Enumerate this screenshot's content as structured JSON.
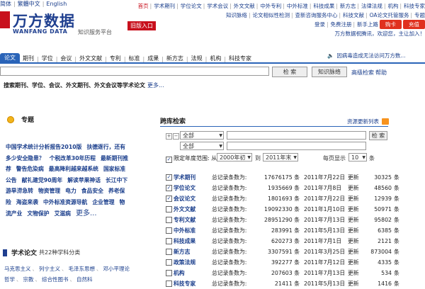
{
  "lang": [
    "简体",
    "繁體中文",
    "English"
  ],
  "logo": {
    "main": "万方数据",
    "sub": "WANFANG DATA",
    "tag": "知识服务平台"
  },
  "old_entry": "旧版入口",
  "topnav": {
    "row1": [
      "首页",
      "学术期刊",
      "学位论文",
      "学术会议",
      "外文文献",
      "中外专利",
      "中外标准",
      "科技成果",
      "新方志",
      "法律法规",
      "机构",
      "科技专家"
    ],
    "row2": [
      "知识脉络",
      "论文相似性检测",
      "查新咨询服务中心",
      "科技文献",
      "OA论文托管服务",
      "专题"
    ],
    "row3": [
      "登录",
      "免费注册",
      "新手上路"
    ],
    "recharge": "购卡",
    "charge": "充值",
    "welcome": "万方数据祝腾讯，欢迎您，主让加入！"
  },
  "tabs": [
    "论文",
    "期刊",
    "学位",
    "会议",
    "外文文献",
    "专利",
    "标准",
    "成果",
    "新方志",
    "法规",
    "机构",
    "科技专家"
  ],
  "notice": "因病毒造成无法访问万方数...",
  "search": {
    "value": "",
    "button": "检 索",
    "vein": "知识脉络",
    "advanced": "高级检索",
    "help": "帮助"
  },
  "hint": {
    "text": "搜索期刊、学位、会议、外文期刊、外文会议等学术论文",
    "more": "更多..."
  },
  "topics": {
    "title": "专题",
    "items": [
      "中国学术统计分析报告2010版",
      "扶德逐行，还有多少安全隐患？",
      "个税改革30年历程",
      "最新期刊推荐",
      "警告危染病",
      "最高降利越来越系统",
      "国家标准公告",
      "献礼建党90周年",
      "解读苹果神话",
      "长江中下游旱涝急转",
      "物资管理",
      "电力",
      "食品安全",
      "养老保险",
      "海盗来袭",
      "中外标准资源导航",
      "企业管理",
      "物流产业",
      "文物保护",
      "艾滋病"
    ],
    "more": "更多..."
  },
  "xslw": {
    "title": "学术论文",
    "sub": "共22种学科分类",
    "row1": [
      "马克思主义",
      "列宁主义",
      "毛泽东思想",
      "邓小平理论"
    ],
    "row2": [
      "哲学",
      "宗教",
      "综合性图书",
      "自然科"
    ]
  },
  "cross": {
    "title": "跨库检索",
    "more": "资源更新列表",
    "field1": "全部",
    "field2": "全部",
    "button": "检 索",
    "range_label": "限定年度范围:",
    "from": "从",
    "from_val": "2000年初",
    "to": "到",
    "to_val": "2011年末",
    "per_page_label": "每页显示",
    "per_page_val": "10",
    "per_page_unit": "条",
    "rows": [
      {
        "name": "学术期刊",
        "checked": true,
        "label": "总记录条数为:",
        "count": "17676175 条",
        "date": "2011年7月22日",
        "upd": "更新",
        "new": "30325",
        "unit": "条"
      },
      {
        "name": "学位论文",
        "checked": true,
        "label": "总记录条数为:",
        "count": "1935669 条",
        "date": "2011年7月8日",
        "upd": "更新",
        "new": "48560",
        "unit": "条"
      },
      {
        "name": "会议论文",
        "checked": true,
        "label": "总记录条数为:",
        "count": "1801693 条",
        "date": "2011年7月22日",
        "upd": "更新",
        "new": "12939",
        "unit": "条"
      },
      {
        "name": "外文文献",
        "checked": false,
        "label": "总记录条数为:",
        "count": "19092330 条",
        "date": "2011年1月10日",
        "upd": "更新",
        "new": "50971",
        "unit": "条"
      },
      {
        "name": "专利文献",
        "checked": false,
        "label": "总记录条数为:",
        "count": "28951290 条",
        "date": "2011年7月13日",
        "upd": "更新",
        "new": "95802",
        "unit": "条"
      },
      {
        "name": "中外标准",
        "checked": false,
        "label": "总记录条数为:",
        "count": "283991 条",
        "date": "2011年5月13日",
        "upd": "更新",
        "new": "6385",
        "unit": "条"
      },
      {
        "name": "科技成果",
        "checked": false,
        "label": "总记录条数为:",
        "count": "620273 条",
        "date": "2011年7月1日",
        "upd": "更新",
        "new": "2121",
        "unit": "条"
      },
      {
        "name": "新方志",
        "checked": false,
        "label": "总记录条数为:",
        "count": "3307591 条",
        "date": "2011年3月25日",
        "upd": "更新",
        "new": "873004",
        "unit": "条"
      },
      {
        "name": "政策法规",
        "checked": false,
        "label": "总记录条数为:",
        "count": "392277 条",
        "date": "2011年7月12日",
        "upd": "更新",
        "new": "4335",
        "unit": "条"
      },
      {
        "name": "机构",
        "checked": false,
        "label": "总记录条数为:",
        "count": "207603 条",
        "date": "2011年7月13日",
        "upd": "更新",
        "new": "534",
        "unit": "条"
      },
      {
        "name": "科技专家",
        "checked": false,
        "label": "总记录条数为:",
        "count": "21411 条",
        "date": "2011年5月13日",
        "upd": "更新",
        "new": "1416",
        "unit": "条"
      }
    ]
  }
}
